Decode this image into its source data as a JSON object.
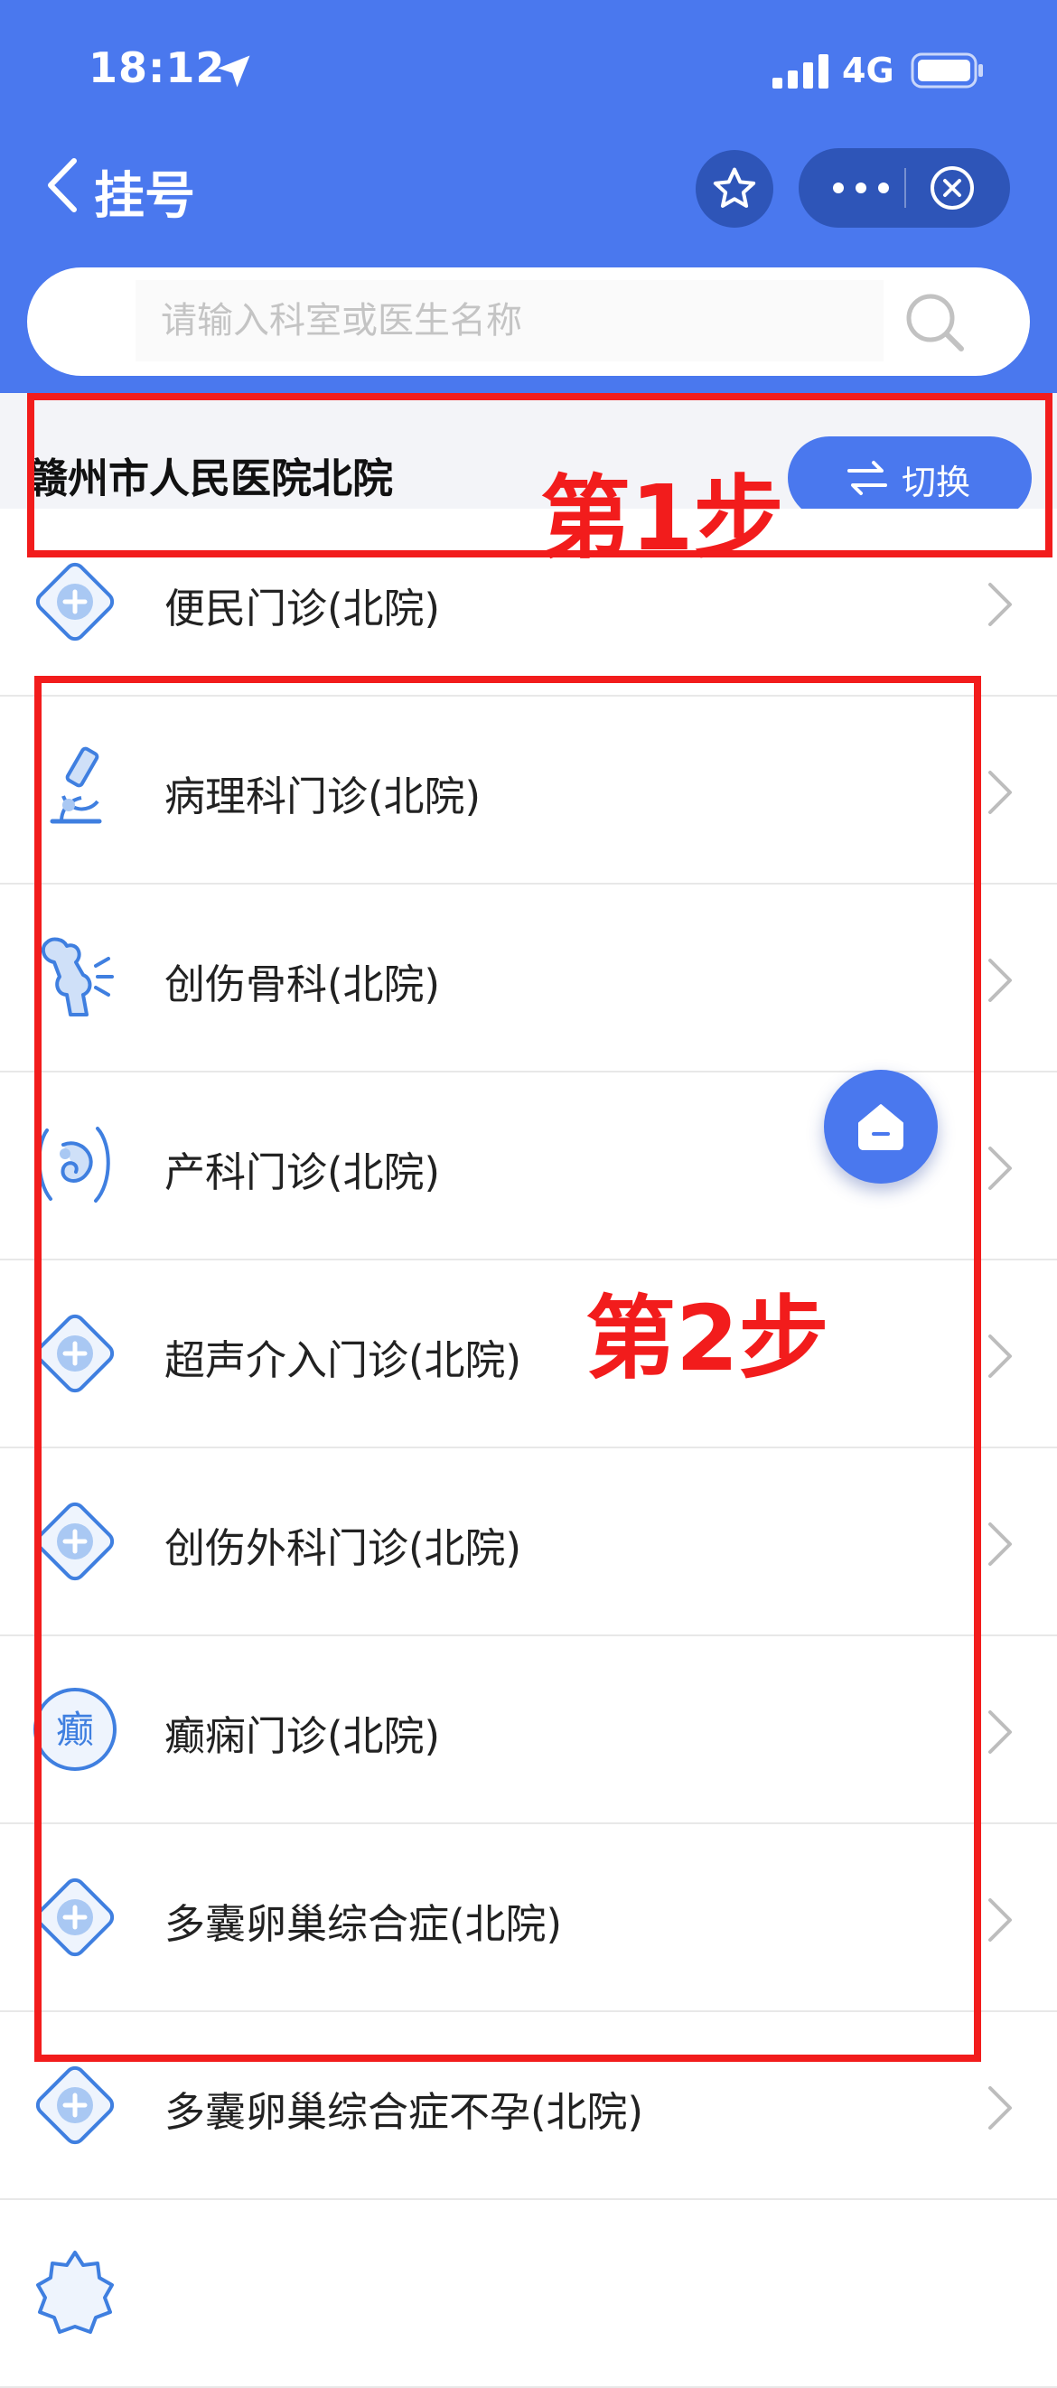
{
  "status_bar": {
    "time": "18:12",
    "network": "4G"
  },
  "nav": {
    "title": "挂号"
  },
  "search": {
    "placeholder": "请输入科室或医生名称"
  },
  "hospital": {
    "name": "赣州市人民医院北院",
    "switch_label": "切换"
  },
  "departments": [
    {
      "label": "便民门诊(北院)",
      "icon": "medical-plus-diamond-icon"
    },
    {
      "label": "病理科门诊(北院)",
      "icon": "microscope-icon"
    },
    {
      "label": "创伤骨科(北院)",
      "icon": "bone-joint-icon"
    },
    {
      "label": "产科门诊(北院)",
      "icon": "pregnancy-icon"
    },
    {
      "label": "超声介入门诊(北院)",
      "icon": "medical-plus-diamond-icon"
    },
    {
      "label": "创伤外科门诊(北院)",
      "icon": "medical-plus-diamond-icon"
    },
    {
      "label": "癫痫门诊(北院)",
      "icon": "epilepsy-character-icon",
      "icon_text": "癫"
    },
    {
      "label": "多囊卵巢综合症(北院)",
      "icon": "medical-plus-diamond-icon"
    },
    {
      "label": "多囊卵巢综合症不孕(北院)",
      "icon": "medical-plus-diamond-icon"
    },
    {
      "label": "",
      "icon": "medical-badge-icon"
    }
  ],
  "annotations": {
    "step1": "第1步",
    "step2": "第2步"
  },
  "colors": {
    "primary": "#4a78ee",
    "primary_dark": "#2e55b8",
    "annotation": "#f21c1c",
    "icon_blue": "#3f7fe0"
  }
}
